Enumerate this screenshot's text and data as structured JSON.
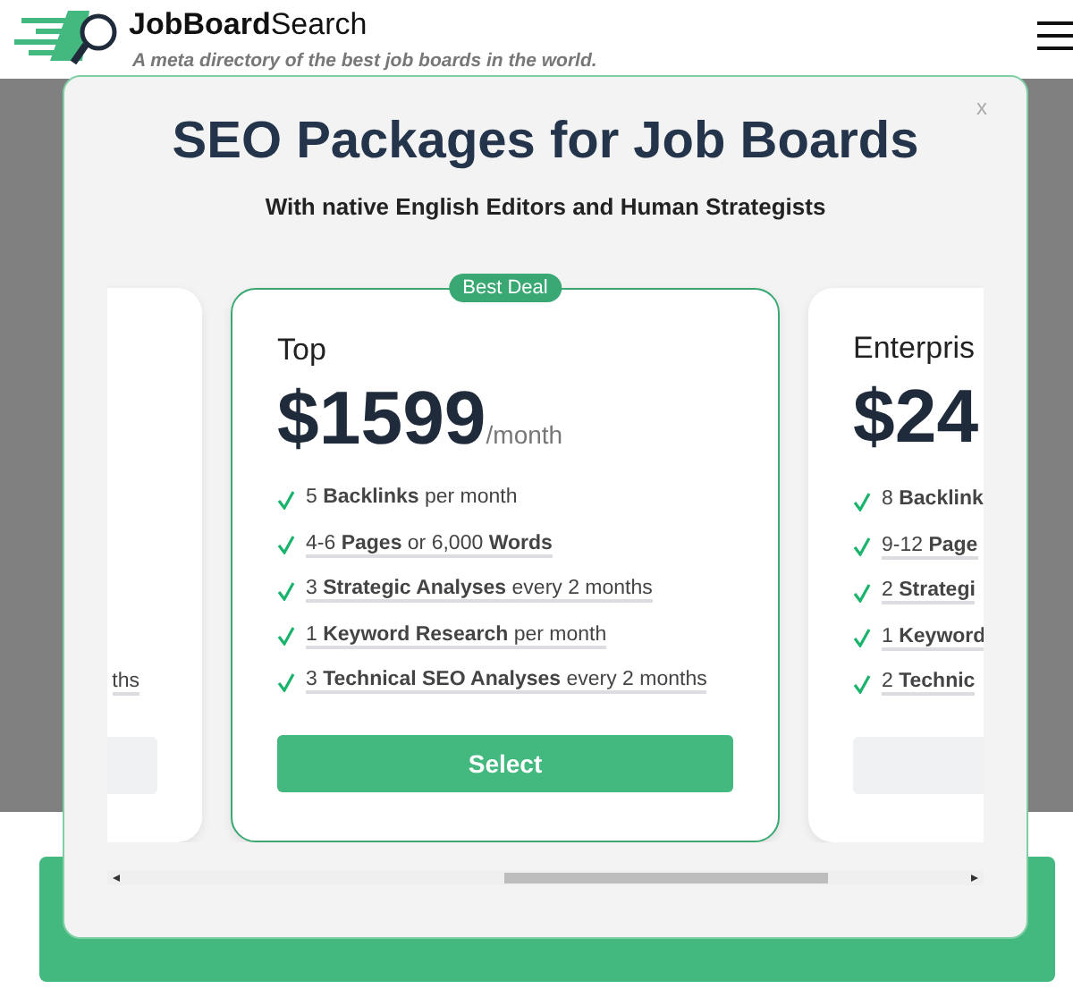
{
  "header": {
    "brand": "**JobBoard**Search",
    "tagline": "A meta directory of the best job boards in the world."
  },
  "background_button": {
    "primary": true
  },
  "modal": {
    "close": "x",
    "title": "SEO Packages for Job Boards",
    "subtitle": "With native English Editors and Human Strategists",
    "plans": [
      {
        "featured": false,
        "features": [
          {
            "text": "ths",
            "has_tooltip": true
          }
        ],
        "button": {
          "primary": false
        }
      },
      {
        "featured": true,
        "badge": "Best Deal",
        "name": "Top",
        "price": "$1599",
        "period": "/month",
        "features": [
          {
            "text": "5 **Backlinks** per month",
            "has_tooltip": false
          },
          {
            "text": "4-6 **Pages** or 6,000 **Words**",
            "has_tooltip": true
          },
          {
            "text": "3 **Strategic Analyses** every 2 months",
            "has_tooltip": true
          },
          {
            "text": "1 **Keyword Research** per month",
            "has_tooltip": true
          },
          {
            "text": "3 **Technical SEO Analyses** every 2 months",
            "has_tooltip": true
          }
        ],
        "button": {
          "label": "Select",
          "primary": true
        }
      },
      {
        "featured": false,
        "name": "Enterpris",
        "price": "$24",
        "features": [
          {
            "text": "8 **Backlink**",
            "has_tooltip": false
          },
          {
            "text": "9-12 **Page**",
            "has_tooltip": true
          },
          {
            "text": "2 **Strategi**",
            "has_tooltip": true
          },
          {
            "text": "1 **Keyword**",
            "has_tooltip": true
          },
          {
            "text": "2 **Technic**",
            "has_tooltip": true
          }
        ],
        "button": {
          "primary": false
        }
      }
    ]
  }
}
